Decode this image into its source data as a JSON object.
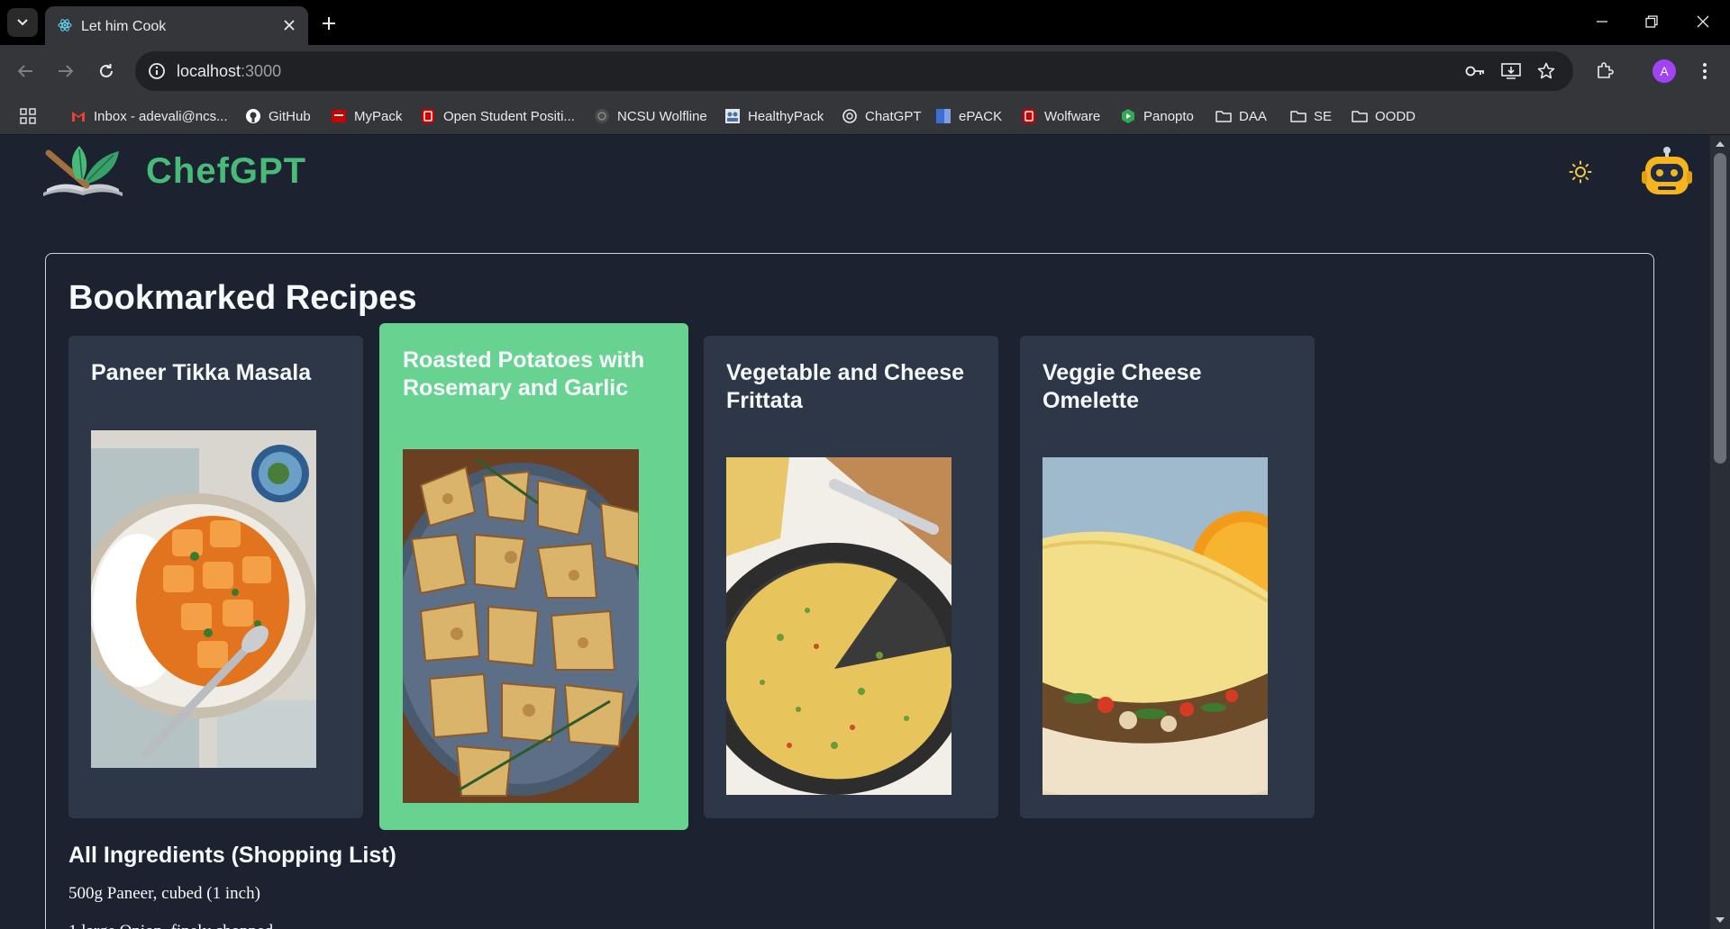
{
  "browser": {
    "tab_title": "Let him Cook",
    "url_host": "localhost",
    "url_port": ":3000",
    "avatar_letter": "A",
    "bookmarks": [
      {
        "label": "Inbox - adevali@ncs...",
        "icon": "gmail-icon",
        "color": "#ea4335"
      },
      {
        "label": "GitHub",
        "icon": "github-icon",
        "color": "#ffffff"
      },
      {
        "label": "MyPack",
        "icon": "mypack-icon",
        "color": "#cc0000"
      },
      {
        "label": "Open Student Positi...",
        "icon": "ncsu-icon",
        "color": "#cc0000"
      },
      {
        "label": "NCSU Wolfline",
        "icon": "wolfline-icon",
        "color": "#555555"
      },
      {
        "label": "HealthyPack",
        "icon": "healthypack-icon",
        "color": "#4a6fa5"
      },
      {
        "label": "ChatGPT",
        "icon": "chatgpt-icon",
        "color": "#ffffff"
      },
      {
        "label": "ePACK",
        "icon": "epack-icon",
        "color": "#3b6fd8"
      },
      {
        "label": "Wolfware",
        "icon": "wolfware-icon",
        "color": "#cc0000"
      },
      {
        "label": "Panopto",
        "icon": "panopto-icon",
        "color": "#34a853"
      },
      {
        "label": "DAA",
        "icon": "folder-icon",
        "color": "#e8eaed"
      },
      {
        "label": "SE",
        "icon": "folder-icon",
        "color": "#e8eaed"
      },
      {
        "label": "OODD",
        "icon": "folder-icon",
        "color": "#e8eaed"
      }
    ]
  },
  "app": {
    "brand": "ChefGPT",
    "accent": "#48bb78",
    "bookmarked_title": "Bookmarked Recipes",
    "recipes": [
      {
        "title": "Paneer Tikka Masala",
        "image": "paneer-tikka-masala-image"
      },
      {
        "title": "Roasted Potatoes with Rosemary and Garlic",
        "image": "roasted-potatoes-image",
        "selected": true
      },
      {
        "title": "Vegetable and Cheese Frittata",
        "image": "frittata-image"
      },
      {
        "title": "Veggie Cheese Omelette",
        "image": "omelette-image"
      }
    ],
    "shopping_title": "All Ingredients (Shopping List)",
    "ingredients": [
      "500g Paneer, cubed (1 inch)",
      "1 large Onion, finely chopped"
    ]
  }
}
